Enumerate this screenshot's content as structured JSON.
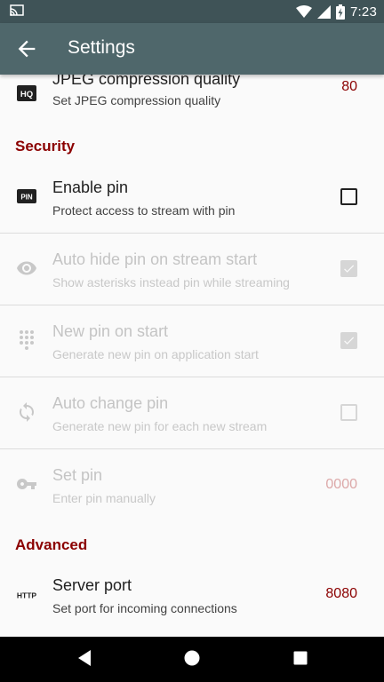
{
  "status_bar": {
    "time": "7:23"
  },
  "app_bar": {
    "title": "Settings"
  },
  "prefs_top": {
    "jpeg": {
      "title": "JPEG compression quality",
      "summary": "Set JPEG compression quality",
      "value": "80"
    }
  },
  "security": {
    "header": "Security",
    "enable_pin": {
      "title": "Enable pin",
      "summary": "Protect access to stream with pin",
      "checked": false
    },
    "auto_hide": {
      "title": "Auto hide pin on stream start",
      "summary": "Show asterisks instead pin while streaming",
      "checked": true
    },
    "new_pin": {
      "title": "New pin on start",
      "summary": "Generate new pin on application start",
      "checked": true
    },
    "auto_change": {
      "title": "Auto change pin",
      "summary": "Generate new pin for each new stream",
      "checked": false
    },
    "set_pin": {
      "title": "Set pin",
      "summary": "Enter pin manually",
      "value": "0000"
    }
  },
  "advanced": {
    "header": "Advanced",
    "server_port": {
      "title": "Server port",
      "summary": "Set port for incoming connections",
      "value": "8080"
    }
  },
  "icons": {
    "hq": "HQ",
    "pin": "PIN",
    "http": "HTTP"
  }
}
